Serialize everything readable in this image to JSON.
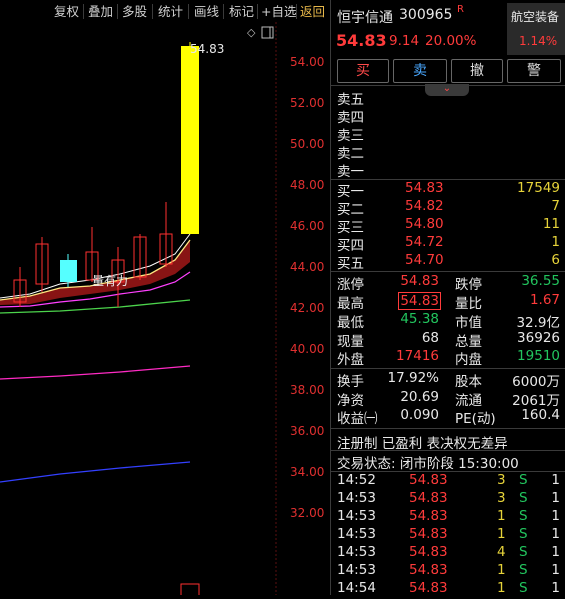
{
  "toolbar": {
    "items": [
      "复权",
      "叠加",
      "多股",
      "统计",
      "画线",
      "标记",
      "+自选"
    ],
    "back": "返回"
  },
  "chart": {
    "price_ticks": [
      "54.00",
      "52.00",
      "50.00",
      "48.00",
      "46.00",
      "44.00",
      "42.00",
      "40.00",
      "38.00",
      "36.00",
      "34.00",
      "32.00"
    ],
    "high_label": "54.83",
    "annotation": "量有力"
  },
  "header": {
    "name": "恒宇信通",
    "code": "300965",
    "r_mark": "R",
    "sector": "航空装备",
    "sector_change": "1.14%",
    "price": "54.83",
    "change": "9.14",
    "change_pct": "20.00%"
  },
  "buttons": {
    "buy": "买",
    "sell": "卖",
    "cancel": "撤",
    "alert": "警"
  },
  "colors": {
    "up": "#ff3b3b",
    "down": "#22c55e",
    "volume": "#e6d33a",
    "limit_bar": "#ffff00"
  },
  "asks": [
    {
      "label": "卖五",
      "price": "",
      "vol": ""
    },
    {
      "label": "卖四",
      "price": "",
      "vol": ""
    },
    {
      "label": "卖三",
      "price": "",
      "vol": ""
    },
    {
      "label": "卖二",
      "price": "",
      "vol": ""
    },
    {
      "label": "卖一",
      "price": "",
      "vol": ""
    }
  ],
  "bids": [
    {
      "label": "买一",
      "price": "54.83",
      "vol": "17549"
    },
    {
      "label": "买二",
      "price": "54.82",
      "vol": "7"
    },
    {
      "label": "买三",
      "price": "54.80",
      "vol": "11"
    },
    {
      "label": "买四",
      "price": "54.72",
      "vol": "1"
    },
    {
      "label": "买五",
      "price": "54.70",
      "vol": "6"
    }
  ],
  "stats": [
    {
      "l1": "涨停",
      "v1": "54.83",
      "l2": "跌停",
      "v2": "36.55"
    },
    {
      "l1": "最高",
      "v1": "54.83",
      "l2": "量比",
      "v2": "1.67"
    },
    {
      "l1": "最低",
      "v1": "45.38",
      "l2": "市值",
      "v2": "32.9亿"
    },
    {
      "l1": "现量",
      "v1": "68",
      "l2": "总量",
      "v2": "36926"
    },
    {
      "l1": "外盘",
      "v1": "17416",
      "l2": "内盘",
      "v2": "19510"
    }
  ],
  "fund": [
    {
      "l1": "换手",
      "v1": "17.92%",
      "l2": "股本",
      "v2": "6000万"
    },
    {
      "l1": "净资",
      "v1": "20.69",
      "l2": "流通",
      "v2": "2061万"
    },
    {
      "l1": "收益㈠",
      "v1": "0.090",
      "l2": "PE(动)",
      "v2": "160.4"
    }
  ],
  "tags": "注册制 已盈利 表决权无差异",
  "status": "交易状态: 闭市阶段 15:30:00",
  "ticks": [
    {
      "time": "14:52",
      "price": "54.83",
      "vol": "3",
      "side": "S",
      "n": "1"
    },
    {
      "time": "14:53",
      "price": "54.83",
      "vol": "3",
      "side": "S",
      "n": "1"
    },
    {
      "time": "14:53",
      "price": "54.83",
      "vol": "1",
      "side": "S",
      "n": "1"
    },
    {
      "time": "14:53",
      "price": "54.83",
      "vol": "1",
      "side": "S",
      "n": "1"
    },
    {
      "time": "14:53",
      "price": "54.83",
      "vol": "4",
      "side": "S",
      "n": "1"
    },
    {
      "time": "14:53",
      "price": "54.83",
      "vol": "1",
      "side": "S",
      "n": "1"
    },
    {
      "time": "14:54",
      "price": "54.83",
      "vol": "1",
      "side": "S",
      "n": "1"
    }
  ]
}
